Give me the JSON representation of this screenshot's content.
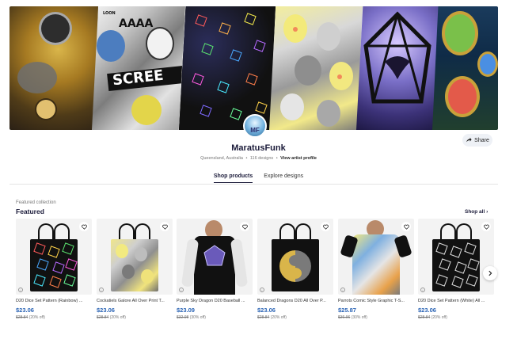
{
  "artist": {
    "name": "MaratusFunk",
    "avatar_text": "MF",
    "location": "Queensland, Australia",
    "design_count": "116 designs",
    "view_profile_label": "View artist profile",
    "share_label": "Share"
  },
  "banner": {
    "comic_text_1": "AAAA",
    "comic_text_2": "SCREE",
    "comic_text_3": "LOON"
  },
  "tabs": [
    {
      "label": "Shop products",
      "active": true
    },
    {
      "label": "Explore designs",
      "active": false
    }
  ],
  "featured": {
    "eyebrow": "Featured collection",
    "title": "Featured",
    "shop_all_label": "Shop all"
  },
  "products": [
    {
      "title": "D20 Dice Set Pattern (Rainbow) ...",
      "price": "$23.06",
      "original_price": "$28.84",
      "discount": "(20% off)",
      "kind": "tote-rainbow-dice"
    },
    {
      "title": "Cockatiels Galore All Over Print T...",
      "price": "$23.06",
      "original_price": "$28.84",
      "discount": "(20% off)",
      "kind": "tote-cockatiels"
    },
    {
      "title": "Purple Sky Dragon D20 Baseball ...",
      "price": "$23.09",
      "original_price": "$32.98",
      "discount": "(30% off)",
      "kind": "baseball-tee"
    },
    {
      "title": "Balanced Dragons D20 All Over P...",
      "price": "$23.06",
      "original_price": "$28.84",
      "discount": "(20% off)",
      "kind": "tote-yin-yang"
    },
    {
      "title": "Parrots Comic Style Graphic T-S...",
      "price": "$25.87",
      "original_price": "$36.96",
      "discount": "(30% off)",
      "kind": "comic-tee"
    },
    {
      "title": "D20 Dice Set Pattern (White) All ...",
      "price": "$23.06",
      "original_price": "$28.84",
      "discount": "(20% off)",
      "kind": "tote-white-dice"
    }
  ],
  "colors": {
    "price": "#2b64b5",
    "heading": "#1b1b3a"
  }
}
